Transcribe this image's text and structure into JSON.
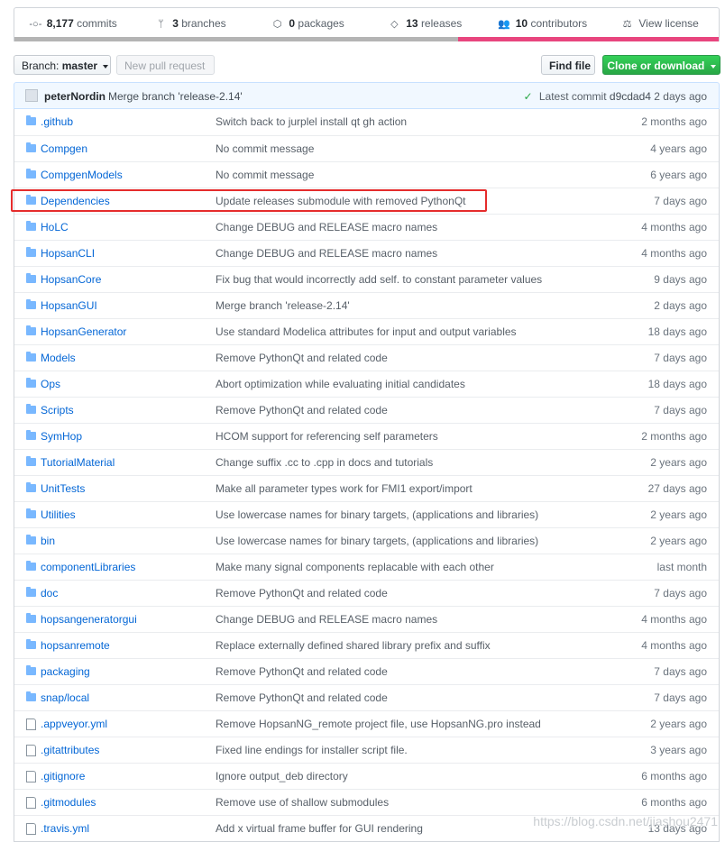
{
  "summary": {
    "commits": {
      "count": "8,177",
      "label": "commits",
      "icon": "commit-icon"
    },
    "branches": {
      "count": "3",
      "label": "branches",
      "icon": "branch-icon"
    },
    "packages": {
      "count": "0",
      "label": "packages",
      "icon": "package-icon"
    },
    "releases": {
      "count": "13",
      "label": "releases",
      "icon": "tag-icon"
    },
    "contributors": {
      "count": "10",
      "label": "contributors",
      "icon": "people-icon"
    },
    "license": {
      "label": "View license",
      "icon": "law-icon"
    },
    "language_colors": [
      "#b4b4b4",
      "#e8457e"
    ]
  },
  "toolbar": {
    "branch_prefix": "Branch:",
    "branch_name": "master",
    "new_pr": "New pull request",
    "find_file": "Find file",
    "clone": "Clone or download"
  },
  "latest_commit": {
    "author": "peterNordin",
    "message": "Merge branch 'release-2.14'",
    "label": "Latest commit",
    "sha": "d9cdad4",
    "age": "2 days ago"
  },
  "files": [
    {
      "name": ".github",
      "type": "dir",
      "message": "Switch back to jurplel install qt gh action",
      "age": "2 months ago"
    },
    {
      "name": "Compgen",
      "type": "dir",
      "message": "No commit message",
      "age": "4 years ago"
    },
    {
      "name": "CompgenModels",
      "type": "dir",
      "message": "No commit message",
      "age": "6 years ago"
    },
    {
      "name": "Dependencies",
      "type": "dir",
      "message": "Update releases submodule with removed PythonQt",
      "age": "7 days ago"
    },
    {
      "name": "HoLC",
      "type": "dir",
      "message": "Change DEBUG and RELEASE macro names",
      "age": "4 months ago"
    },
    {
      "name": "HopsanCLI",
      "type": "dir",
      "message": "Change DEBUG and RELEASE macro names",
      "age": "4 months ago"
    },
    {
      "name": "HopsanCore",
      "type": "dir",
      "message": "Fix bug that would incorrectly add self. to constant parameter values",
      "age": "9 days ago"
    },
    {
      "name": "HopsanGUI",
      "type": "dir",
      "message": "Merge branch 'release-2.14'",
      "age": "2 days ago"
    },
    {
      "name": "HopsanGenerator",
      "type": "dir",
      "message": "Use standard Modelica attributes for input and output variables",
      "age": "18 days ago"
    },
    {
      "name": "Models",
      "type": "dir",
      "message": "Remove PythonQt and related code",
      "age": "7 days ago"
    },
    {
      "name": "Ops",
      "type": "dir",
      "message": "Abort optimization while evaluating initial candidates",
      "age": "18 days ago"
    },
    {
      "name": "Scripts",
      "type": "dir",
      "message": "Remove PythonQt and related code",
      "age": "7 days ago"
    },
    {
      "name": "SymHop",
      "type": "dir",
      "message": "HCOM support for referencing self parameters",
      "age": "2 months ago"
    },
    {
      "name": "TutorialMaterial",
      "type": "dir",
      "message": "Change suffix .cc to .cpp in docs and tutorials",
      "age": "2 years ago"
    },
    {
      "name": "UnitTests",
      "type": "dir",
      "message": "Make all parameter types work for FMI1 export/import",
      "age": "27 days ago"
    },
    {
      "name": "Utilities",
      "type": "dir",
      "message": "Use lowercase names for binary targets, (applications and libraries)",
      "age": "2 years ago"
    },
    {
      "name": "bin",
      "type": "dir",
      "message": "Use lowercase names for binary targets, (applications and libraries)",
      "age": "2 years ago"
    },
    {
      "name": "componentLibraries",
      "type": "dir",
      "message": "Make many signal components replacable with each other",
      "age": "last month"
    },
    {
      "name": "doc",
      "type": "dir",
      "message": "Remove PythonQt and related code",
      "age": "7 days ago"
    },
    {
      "name": "hopsangeneratorgui",
      "type": "dir",
      "message": "Change DEBUG and RELEASE macro names",
      "age": "4 months ago"
    },
    {
      "name": "hopsanremote",
      "type": "dir",
      "message": "Replace externally defined shared library prefix and suffix",
      "age": "4 months ago"
    },
    {
      "name": "packaging",
      "type": "dir",
      "message": "Remove PythonQt and related code",
      "age": "7 days ago"
    },
    {
      "name": "snap/local",
      "type": "dir",
      "message": "Remove PythonQt and related code",
      "age": "7 days ago"
    },
    {
      "name": ".appveyor.yml",
      "type": "file",
      "message": "Remove HopsanNG_remote project file, use HopsanNG.pro instead",
      "age": "2 years ago"
    },
    {
      "name": ".gitattributes",
      "type": "file",
      "message": "Fixed line endings for installer script file.",
      "age": "3 years ago"
    },
    {
      "name": ".gitignore",
      "type": "file",
      "message": "Ignore output_deb directory",
      "age": "6 months ago"
    },
    {
      "name": ".gitmodules",
      "type": "file",
      "message": "Remove use of shallow submodules",
      "age": "6 months ago"
    },
    {
      "name": ".travis.yml",
      "type": "file",
      "message": "Add x virtual frame buffer for GUI rendering",
      "age": "13 days ago"
    }
  ],
  "watermark": "https://blog.csdn.net/jiashou2471"
}
